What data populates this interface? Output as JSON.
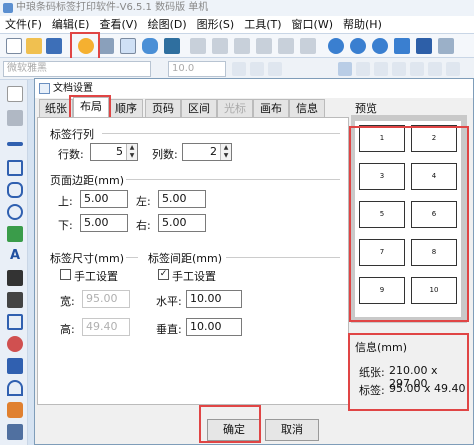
{
  "window": {
    "title": "中琅条码标签打印软件-V6.5.1 数码版 单机"
  },
  "menu": [
    "文件(F)",
    "编辑(E)",
    "查看(V)",
    "绘图(D)",
    "图形(S)",
    "工具(T)",
    "窗口(W)",
    "帮助(H)"
  ],
  "formatbar": {
    "font_name": "微软雅黑",
    "font_size": "10.0"
  },
  "dialog": {
    "title": "文档设置",
    "tabs": [
      "纸张",
      "布局",
      "顺序",
      "页码",
      "区间",
      "光标",
      "画布",
      "信息"
    ],
    "active_tab": "布局",
    "label_rows_group": {
      "title": "标签行列",
      "rows_label": "行数:",
      "rows_value": "5",
      "cols_label": "列数:",
      "cols_value": "2"
    },
    "margins_group": {
      "title": "页面边距(mm)",
      "top_label": "上:",
      "top_value": "5.00",
      "left_label": "左:",
      "left_value": "5.00",
      "bottom_label": "下:",
      "bottom_value": "5.00",
      "right_label": "右:",
      "right_value": "5.00"
    },
    "label_size_group": {
      "title": "标签尺寸(mm)",
      "manual_label": "手工设置",
      "manual_checked": false,
      "width_label": "宽:",
      "width_value": "95.00",
      "height_label": "高:",
      "height_value": "49.40"
    },
    "label_spacing_group": {
      "title": "标签间距(mm)",
      "manual_label": "手工设置",
      "manual_checked": true,
      "horizontal_label": "水平:",
      "horizontal_value": "10.00",
      "vertical_label": "垂直:",
      "vertical_value": "10.00"
    },
    "preview": {
      "title": "预览",
      "cells": [
        "1",
        "2",
        "3",
        "4",
        "5",
        "6",
        "7",
        "8",
        "9",
        "10"
      ]
    },
    "info": {
      "title": "信息(mm)",
      "paper_label": "纸张:",
      "paper_value": "210.00 x 297.00",
      "label_label": "标签:",
      "label_value": "95.00 x 49.40"
    },
    "ok_label": "确定",
    "cancel_label": "取消",
    "checkmark": "✓"
  },
  "colors": {
    "highlight": "#e04545",
    "accent": "#5b8fd0"
  }
}
